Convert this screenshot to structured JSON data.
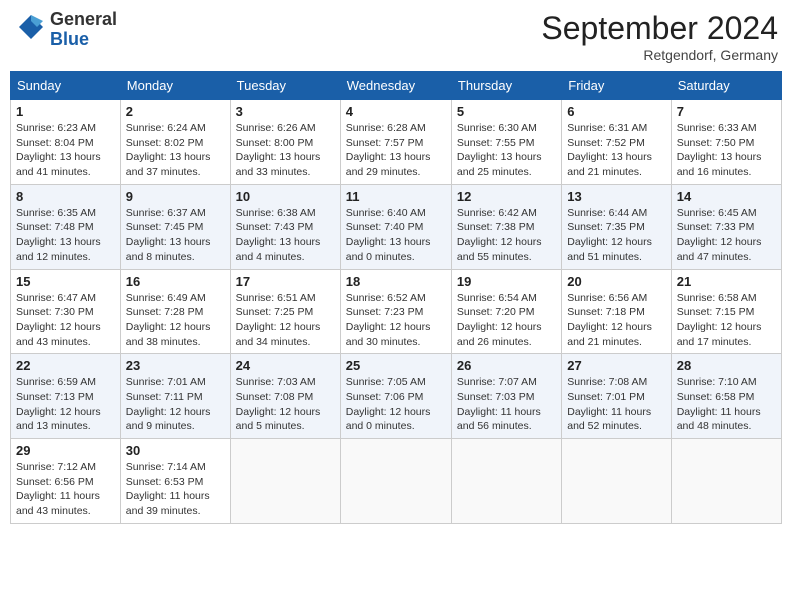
{
  "header": {
    "logo_line1": "General",
    "logo_line2": "Blue",
    "month_title": "September 2024",
    "location": "Retgendorf, Germany"
  },
  "weekdays": [
    "Sunday",
    "Monday",
    "Tuesday",
    "Wednesday",
    "Thursday",
    "Friday",
    "Saturday"
  ],
  "weeks": [
    [
      {
        "day": "1",
        "sunrise": "6:23 AM",
        "sunset": "8:04 PM",
        "daylight": "13 hours and 41 minutes."
      },
      {
        "day": "2",
        "sunrise": "6:24 AM",
        "sunset": "8:02 PM",
        "daylight": "13 hours and 37 minutes."
      },
      {
        "day": "3",
        "sunrise": "6:26 AM",
        "sunset": "8:00 PM",
        "daylight": "13 hours and 33 minutes."
      },
      {
        "day": "4",
        "sunrise": "6:28 AM",
        "sunset": "7:57 PM",
        "daylight": "13 hours and 29 minutes."
      },
      {
        "day": "5",
        "sunrise": "6:30 AM",
        "sunset": "7:55 PM",
        "daylight": "13 hours and 25 minutes."
      },
      {
        "day": "6",
        "sunrise": "6:31 AM",
        "sunset": "7:52 PM",
        "daylight": "13 hours and 21 minutes."
      },
      {
        "day": "7",
        "sunrise": "6:33 AM",
        "sunset": "7:50 PM",
        "daylight": "13 hours and 16 minutes."
      }
    ],
    [
      {
        "day": "8",
        "sunrise": "6:35 AM",
        "sunset": "7:48 PM",
        "daylight": "13 hours and 12 minutes."
      },
      {
        "day": "9",
        "sunrise": "6:37 AM",
        "sunset": "7:45 PM",
        "daylight": "13 hours and 8 minutes."
      },
      {
        "day": "10",
        "sunrise": "6:38 AM",
        "sunset": "7:43 PM",
        "daylight": "13 hours and 4 minutes."
      },
      {
        "day": "11",
        "sunrise": "6:40 AM",
        "sunset": "7:40 PM",
        "daylight": "13 hours and 0 minutes."
      },
      {
        "day": "12",
        "sunrise": "6:42 AM",
        "sunset": "7:38 PM",
        "daylight": "12 hours and 55 minutes."
      },
      {
        "day": "13",
        "sunrise": "6:44 AM",
        "sunset": "7:35 PM",
        "daylight": "12 hours and 51 minutes."
      },
      {
        "day": "14",
        "sunrise": "6:45 AM",
        "sunset": "7:33 PM",
        "daylight": "12 hours and 47 minutes."
      }
    ],
    [
      {
        "day": "15",
        "sunrise": "6:47 AM",
        "sunset": "7:30 PM",
        "daylight": "12 hours and 43 minutes."
      },
      {
        "day": "16",
        "sunrise": "6:49 AM",
        "sunset": "7:28 PM",
        "daylight": "12 hours and 38 minutes."
      },
      {
        "day": "17",
        "sunrise": "6:51 AM",
        "sunset": "7:25 PM",
        "daylight": "12 hours and 34 minutes."
      },
      {
        "day": "18",
        "sunrise": "6:52 AM",
        "sunset": "7:23 PM",
        "daylight": "12 hours and 30 minutes."
      },
      {
        "day": "19",
        "sunrise": "6:54 AM",
        "sunset": "7:20 PM",
        "daylight": "12 hours and 26 minutes."
      },
      {
        "day": "20",
        "sunrise": "6:56 AM",
        "sunset": "7:18 PM",
        "daylight": "12 hours and 21 minutes."
      },
      {
        "day": "21",
        "sunrise": "6:58 AM",
        "sunset": "7:15 PM",
        "daylight": "12 hours and 17 minutes."
      }
    ],
    [
      {
        "day": "22",
        "sunrise": "6:59 AM",
        "sunset": "7:13 PM",
        "daylight": "12 hours and 13 minutes."
      },
      {
        "day": "23",
        "sunrise": "7:01 AM",
        "sunset": "7:11 PM",
        "daylight": "12 hours and 9 minutes."
      },
      {
        "day": "24",
        "sunrise": "7:03 AM",
        "sunset": "7:08 PM",
        "daylight": "12 hours and 5 minutes."
      },
      {
        "day": "25",
        "sunrise": "7:05 AM",
        "sunset": "7:06 PM",
        "daylight": "12 hours and 0 minutes."
      },
      {
        "day": "26",
        "sunrise": "7:07 AM",
        "sunset": "7:03 PM",
        "daylight": "11 hours and 56 minutes."
      },
      {
        "day": "27",
        "sunrise": "7:08 AM",
        "sunset": "7:01 PM",
        "daylight": "11 hours and 52 minutes."
      },
      {
        "day": "28",
        "sunrise": "7:10 AM",
        "sunset": "6:58 PM",
        "daylight": "11 hours and 48 minutes."
      }
    ],
    [
      {
        "day": "29",
        "sunrise": "7:12 AM",
        "sunset": "6:56 PM",
        "daylight": "11 hours and 43 minutes."
      },
      {
        "day": "30",
        "sunrise": "7:14 AM",
        "sunset": "6:53 PM",
        "daylight": "11 hours and 39 minutes."
      },
      null,
      null,
      null,
      null,
      null
    ]
  ],
  "labels": {
    "sunrise": "Sunrise:",
    "sunset": "Sunset:",
    "daylight": "Daylight:"
  }
}
